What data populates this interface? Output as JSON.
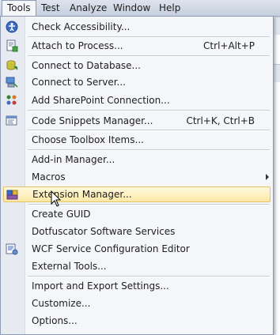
{
  "menubar": {
    "items": [
      "Tools",
      "Test",
      "Analyze",
      "Window",
      "Help"
    ],
    "active": "Tools"
  },
  "tools_menu": {
    "items": [
      {
        "label": "Check Accessibility...",
        "icon": "accessibility-icon"
      },
      {
        "label": "Attach to Process...",
        "shortcut": "Ctrl+Alt+P",
        "icon": "attach-process-icon"
      },
      {
        "label": "Connect to Database...",
        "icon": "database-icon"
      },
      {
        "label": "Connect to Server...",
        "icon": "server-icon"
      },
      {
        "label": "Add SharePoint Connection...",
        "icon": "sharepoint-icon"
      },
      {
        "label": "Code Snippets Manager...",
        "shortcut": "Ctrl+K, Ctrl+B",
        "icon": "snippets-icon"
      },
      {
        "label": "Choose Toolbox Items..."
      },
      {
        "label": "Add-in Manager..."
      },
      {
        "label": "Macros",
        "submenu": true
      },
      {
        "label": "Extension Manager...",
        "icon": "extension-manager-icon",
        "highlighted": true
      },
      {
        "label": "Create GUID"
      },
      {
        "label": "Dotfuscator Software Services"
      },
      {
        "label": "WCF Service Configuration Editor",
        "icon": "wcf-config-icon"
      },
      {
        "label": "External Tools..."
      },
      {
        "label": "Import and Export Settings..."
      },
      {
        "label": "Customize..."
      },
      {
        "label": "Options..."
      }
    ]
  },
  "colors": {
    "menu_bg": "#f4f6f9",
    "gutter": "#e7ebf1",
    "highlight": "#fde9a6",
    "highlight_border": "#e5c365"
  }
}
